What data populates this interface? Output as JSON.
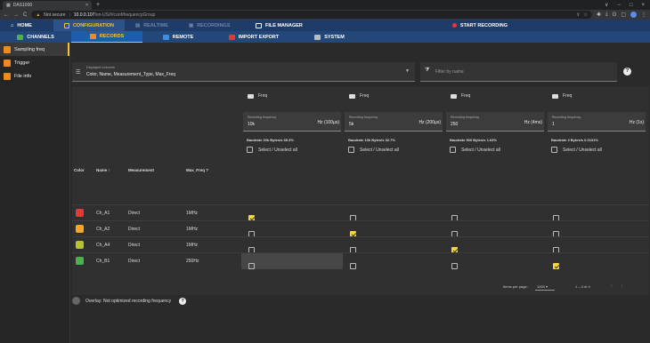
{
  "browser": {
    "tab_title": "DAS1000",
    "tab_close": "×",
    "new_tab": "+",
    "window_controls": [
      "∨",
      "−",
      "□",
      "×"
    ],
    "nav_icons": [
      "←",
      "→",
      "C"
    ],
    "url_warning": "Not secure",
    "url_host": "10.0.0.107",
    "url_path": "/en-US/#/conf/frequencyGroup",
    "toolbar_icons": [
      "share-icon",
      "star-icon",
      "extension-icon",
      "download-icon",
      "google-icon",
      "sidepanel-icon",
      "profile-icon",
      "menu-icon"
    ],
    "toolbar_glyphs": [
      "⇪",
      "☆",
      "✱",
      "⤓",
      "G",
      "▢",
      "⋮"
    ]
  },
  "nav_main": {
    "items": [
      {
        "label": "HOME",
        "state": "normal"
      },
      {
        "label": "CONFIGURATION",
        "state": "active"
      },
      {
        "label": "REALTIME",
        "state": "disabled"
      },
      {
        "label": "RECORDINGS",
        "state": "disabled"
      },
      {
        "label": "FILE MANAGER",
        "state": "normal"
      }
    ],
    "record_label": "START RECORDING"
  },
  "nav_sub": {
    "items": [
      {
        "label": "CHANNELS",
        "state": "normal"
      },
      {
        "label": "RECORDS",
        "state": "active"
      },
      {
        "label": "REMOTE",
        "state": "normal"
      },
      {
        "label": "IMPORT EXPORT",
        "state": "normal"
      },
      {
        "label": "SYSTEM",
        "state": "normal"
      }
    ]
  },
  "sidebar": {
    "items": [
      {
        "label": "Sampling freq",
        "active": true
      },
      {
        "label": "Trigger",
        "active": false
      },
      {
        "label": "File info",
        "active": false
      }
    ]
  },
  "columns_select": {
    "label": "Displayed columns",
    "value": "Color, Name, Measurement_Type, Max_Freq",
    "arrow": "▼"
  },
  "filter": {
    "placeholder": "Filter by name",
    "icon_glyph": "⧩"
  },
  "help_glyph": "?",
  "table": {
    "headers": {
      "color": "Color",
      "name": "Name ↑",
      "measurement": "Measurement",
      "max_freq": "Max_Freq"
    },
    "freq_groups": [
      {
        "title": "Freq",
        "rec_label": "Recording frequency",
        "rec_value": "10k",
        "rec_unit": "Hz (100µs)",
        "baudrate": "Baudrate 20k Bytes/s 65.3%",
        "select_all": "Select / Unselect all"
      },
      {
        "title": "Freq",
        "rec_label": "Recording frequency",
        "rec_value": "5k",
        "rec_unit": "Hz (200µs)",
        "baudrate": "Baudrate 10k Bytes/s 32.7%",
        "select_all": "Select / Unselect all"
      },
      {
        "title": "Freq",
        "rec_label": "Recording frequency",
        "rec_value": "250",
        "rec_unit": "Hz (4ms)",
        "baudrate": "Baudrate 500 Bytes/s 1.63%",
        "select_all": "Select / Unselect all"
      },
      {
        "title": "Freq",
        "rec_label": "Recording frequency",
        "rec_value": "1",
        "rec_unit": "Hz (1s)",
        "baudrate": "Baudrate 4 Bytes/s 0.0131%",
        "select_all": "Select / Unselect all"
      }
    ],
    "rows": [
      {
        "color": "#e53935",
        "name": "Ch_A1",
        "measurement": "Direct",
        "max_freq": "1MHz",
        "checks": [
          true,
          false,
          false,
          false
        ]
      },
      {
        "color": "#f5a623",
        "name": "Ch_A2",
        "measurement": "Direct",
        "max_freq": "1MHz",
        "checks": [
          false,
          true,
          false,
          false
        ]
      },
      {
        "color": "#b5c427",
        "name": "Ch_A4",
        "measurement": "Direct",
        "max_freq": "1MHz",
        "checks": [
          false,
          false,
          true,
          false
        ]
      },
      {
        "color": "#4caf50",
        "name": "Ch_B1",
        "measurement": "Direct",
        "max_freq": "250Hz",
        "checks": [
          false,
          false,
          false,
          true
        ]
      }
    ]
  },
  "pager": {
    "items_per_page_label": "Items per page:",
    "items_per_page_value": "1000",
    "range": "1 – 4 of 4",
    "prev": "‹",
    "next": "›"
  },
  "overlay": {
    "label": "Overlay: Not optimized recording frequency"
  }
}
